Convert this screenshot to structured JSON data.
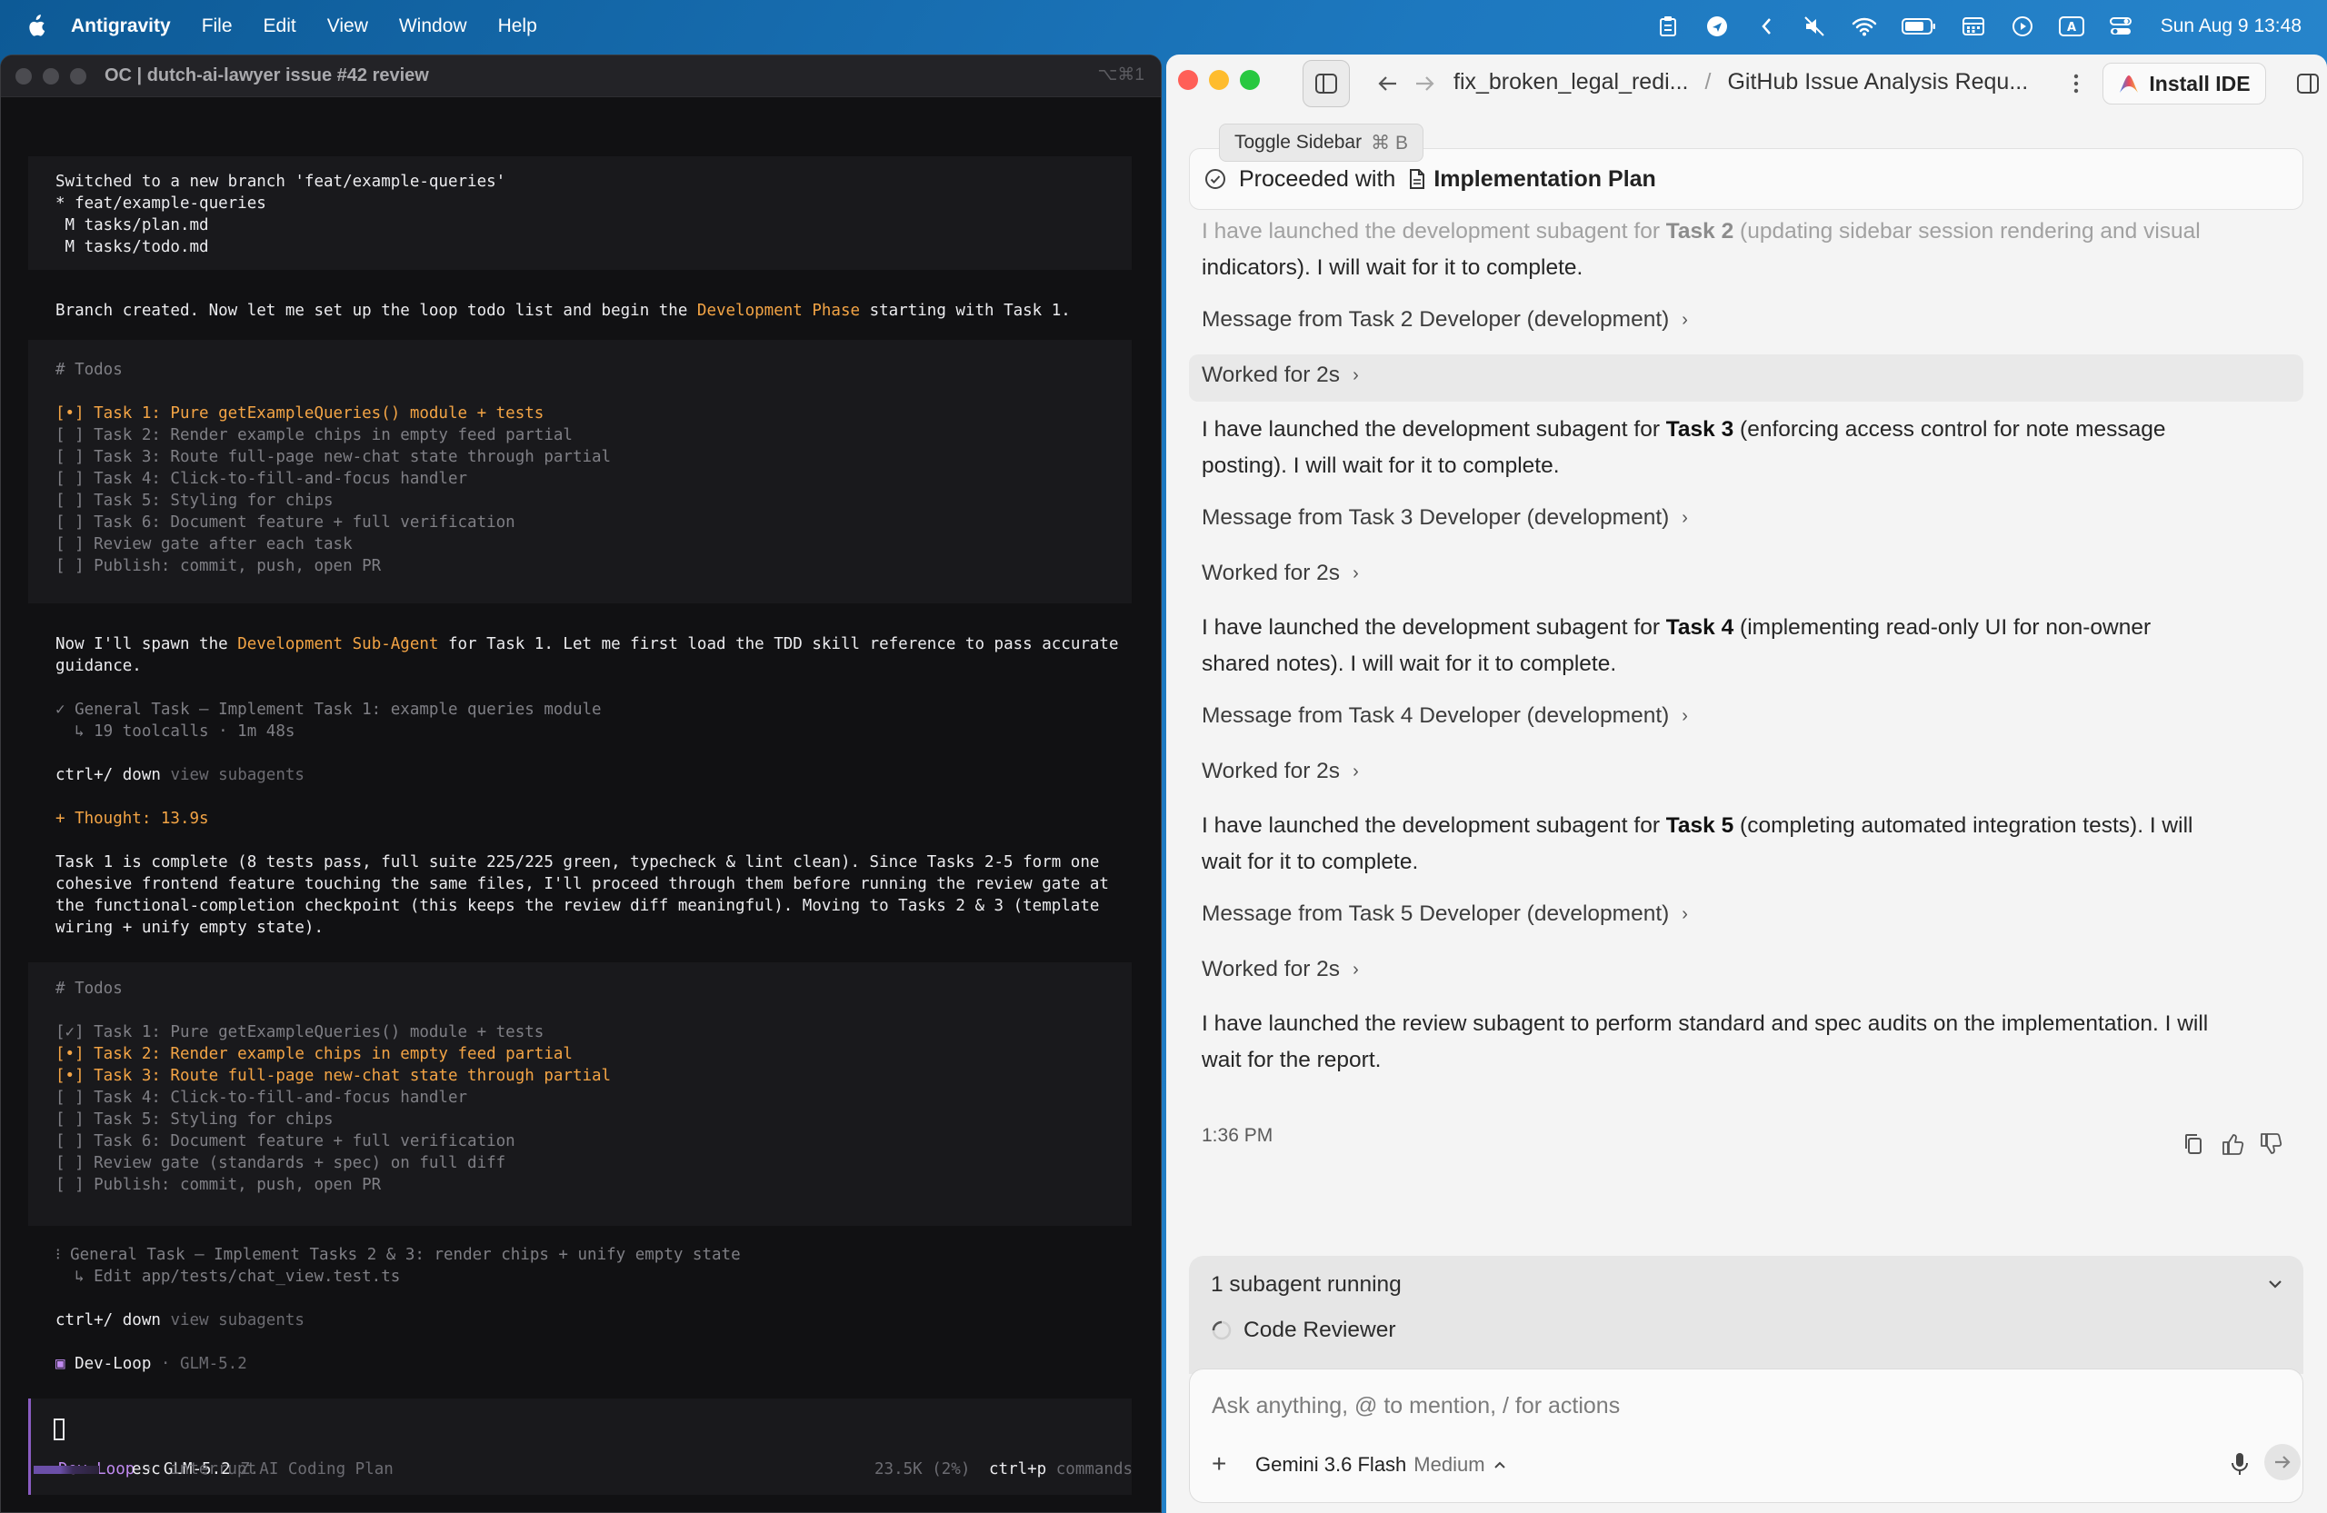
{
  "menubar": {
    "app_name": "Antigravity",
    "menus": [
      "File",
      "Edit",
      "View",
      "Window",
      "Help"
    ],
    "clock": "Sun Aug 9  13:48"
  },
  "terminal": {
    "title": "OC | dutch-ai-lawyer issue #42 review",
    "shortcut": "⌥⌘1",
    "block1": [
      "Switched to a new branch 'feat/example-queries'",
      "* feat/example-queries",
      " M tasks/plan.md",
      " M tasks/todo.md"
    ],
    "branch_msg_pre": "Branch created. Now let me set up the loop todo list and begin the ",
    "branch_msg_hl": "Development Phase",
    "branch_msg_post": " starting with Task 1.",
    "todos_header": "# Todos",
    "todos1_active": "[•] Task 1: Pure getExampleQueries() module + tests",
    "todos1_rest": [
      "[ ] Task 2: Render example chips in empty feed partial",
      "[ ] Task 3: Route full-page new-chat state through partial",
      "[ ] Task 4: Click-to-fill-and-focus handler",
      "[ ] Task 5: Styling for chips",
      "[ ] Task 6: Document feature + full verification",
      "[ ] Review gate after each task",
      "[ ] Publish: commit, push, open PR"
    ],
    "spawn_pre": "Now I'll spawn the ",
    "spawn_hl": "Development Sub-Agent",
    "spawn_post": " for Task 1. Let me first load the TDD skill reference to pass accurate",
    "spawn_line2": "guidance.",
    "task1_done": "✓ General Task — Implement Task 1: example queries module",
    "task1_meta": "  ↳ 19 toolcalls · 1m 48s",
    "ctrl_key": "ctrl+/ down",
    "ctrl_text": " view subagents",
    "thought": "+ Thought: 13.9s",
    "summary": [
      "Task 1 is complete (8 tests pass, full suite 225/225 green, typecheck & lint clean). Since Tasks 2-5 form one",
      "cohesive frontend feature touching the same files, I'll proceed through them before running the review gate at",
      "the functional-completion checkpoint (this keeps the review diff meaningful). Moving to Tasks 2 & 3 (template",
      "wiring + unify empty state)."
    ],
    "todos2_done": "[✓] Task 1: Pure getExampleQueries() module + tests",
    "todos2_active": [
      "[•] Task 2: Render example chips in empty feed partial",
      "[•] Task 3: Route full-page new-chat state through partial"
    ],
    "todos2_rest": [
      "[ ] Task 4: Click-to-fill-and-focus handler",
      "[ ] Task 5: Styling for chips",
      "[ ] Task 6: Document feature + full verification",
      "[ ] Review gate (standards + spec) on full diff",
      "[ ] Publish: commit, push, open PR"
    ],
    "task23": "⁝ General Task — Implement Tasks 2 & 3: render chips + unify empty state",
    "task23_meta": "  ↳ Edit app/tests/chat_view.test.ts",
    "devloop_name": "Dev-Loop",
    "devloop_model": " · GLM-5.2",
    "input_agent": "Dev-Loop",
    "input_sep": " · ",
    "input_model": "GLM-5.2",
    "input_plan": " Z.AI Coding Plan",
    "esc_key": "esc",
    "esc_text": " interrupt",
    "tokens": "23.5K (2%)",
    "cmd_key": "ctrl+p",
    "cmd_text": " commands"
  },
  "chat": {
    "breadcrumb_project": "fix_broken_legal_redi...",
    "breadcrumb_sep": "/",
    "breadcrumb_conv": "GitHub Issue Analysis Requ...",
    "install_ide": "Install IDE",
    "tooltip_label": "Toggle Sidebar",
    "tooltip_keys": "⌘ B",
    "proceeded_label": "Proceeded with",
    "proceeded_doc": "Implementation Plan",
    "p_task2_pre": "I have launched the development subagent for ",
    "p_task2_b": "Task 2",
    "p_task2_post": " (updating sidebar session rendering and visual",
    "p_task2_l2": "indicators). I will wait for it to complete.",
    "msg2": "Message from Task 2 Developer (development)",
    "worked": "Worked for 2s",
    "p_task3_pre": "I have launched the development subagent for ",
    "p_task3_b": "Task 3",
    "p_task3_post": " (enforcing access control for note message",
    "p_task3_l2": "posting). I will wait for it to complete.",
    "msg3": "Message from Task 3 Developer (development)",
    "p_task4_pre": "I have launched the development subagent for ",
    "p_task4_b": "Task 4",
    "p_task4_post": " (implementing read-only UI for non-owner",
    "p_task4_l2": "shared notes). I will wait for it to complete.",
    "msg4": "Message from Task 4 Developer (development)",
    "p_task5_pre": "I have launched the development subagent for ",
    "p_task5_b": "Task 5",
    "p_task5_post": " (completing automated integration tests). I will",
    "p_task5_l2": "wait for it to complete.",
    "msg5": "Message from Task 5 Developer (development)",
    "p_review_l1": "I have launched the review subagent to perform standard and spec audits on the implementation. I will",
    "p_review_l2": "wait for the report.",
    "timestamp": "1:36 PM",
    "subagents_header": "1 subagent running",
    "subagent_name": "Code Reviewer",
    "input_placeholder": "Ask anything, @ to mention, / for actions",
    "model_name": "Gemini 3.6 Flash",
    "model_mode": "Medium"
  },
  "colors": {
    "accent_orange": "#f3a445",
    "accent_purple": "#c08af0",
    "terminal_bg": "#111113",
    "chat_bg": "#f4f4f4"
  }
}
